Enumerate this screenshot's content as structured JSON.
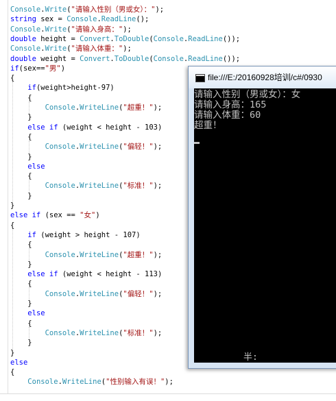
{
  "editor": {
    "lines": [
      [
        {
          "c": "t",
          "v": "Console"
        },
        {
          "c": "",
          "v": "."
        },
        {
          "c": "t",
          "v": "Write"
        },
        {
          "c": "",
          "v": "("
        },
        {
          "c": "s",
          "v": "\"请输入性别（男或女）：\""
        },
        {
          "c": "",
          "v": ");"
        }
      ],
      [
        {
          "c": "k",
          "v": "string"
        },
        {
          "c": "",
          "v": " sex = "
        },
        {
          "c": "t",
          "v": "Console"
        },
        {
          "c": "",
          "v": "."
        },
        {
          "c": "t",
          "v": "ReadLine"
        },
        {
          "c": "",
          "v": "();"
        }
      ],
      [
        {
          "c": "t",
          "v": "Console"
        },
        {
          "c": "",
          "v": "."
        },
        {
          "c": "t",
          "v": "Write"
        },
        {
          "c": "",
          "v": "("
        },
        {
          "c": "s",
          "v": "\"请输入身高：\""
        },
        {
          "c": "",
          "v": ");"
        }
      ],
      [
        {
          "c": "k",
          "v": "double"
        },
        {
          "c": "",
          "v": " height = "
        },
        {
          "c": "t",
          "v": "Convert"
        },
        {
          "c": "",
          "v": "."
        },
        {
          "c": "t",
          "v": "ToDouble"
        },
        {
          "c": "",
          "v": "("
        },
        {
          "c": "t",
          "v": "Console"
        },
        {
          "c": "",
          "v": "."
        },
        {
          "c": "t",
          "v": "ReadLine"
        },
        {
          "c": "",
          "v": "());"
        }
      ],
      [
        {
          "c": "t",
          "v": "Console"
        },
        {
          "c": "",
          "v": "."
        },
        {
          "c": "t",
          "v": "Write"
        },
        {
          "c": "",
          "v": "("
        },
        {
          "c": "s",
          "v": "\"请输入体重：\""
        },
        {
          "c": "",
          "v": ");"
        }
      ],
      [
        {
          "c": "k",
          "v": "double"
        },
        {
          "c": "",
          "v": " weight = "
        },
        {
          "c": "t",
          "v": "Convert"
        },
        {
          "c": "",
          "v": "."
        },
        {
          "c": "t",
          "v": "ToDouble"
        },
        {
          "c": "",
          "v": "("
        },
        {
          "c": "t",
          "v": "Console"
        },
        {
          "c": "",
          "v": "."
        },
        {
          "c": "t",
          "v": "ReadLine"
        },
        {
          "c": "",
          "v": "());"
        }
      ],
      [
        {
          "c": "k",
          "v": "if"
        },
        {
          "c": "",
          "v": "(sex=="
        },
        {
          "c": "s",
          "v": "\"男\""
        },
        {
          "c": "",
          "v": ")"
        }
      ],
      [
        {
          "c": "",
          "v": "{"
        }
      ],
      [
        {
          "c": "",
          "v": "    "
        },
        {
          "c": "k",
          "v": "if"
        },
        {
          "c": "",
          "v": "(weight>height-97)"
        }
      ],
      [
        {
          "c": "",
          "v": "    {"
        }
      ],
      [
        {
          "c": "",
          "v": "        "
        },
        {
          "c": "t",
          "v": "Console"
        },
        {
          "c": "",
          "v": "."
        },
        {
          "c": "t",
          "v": "WriteLine"
        },
        {
          "c": "",
          "v": "("
        },
        {
          "c": "s",
          "v": "\"超重！\""
        },
        {
          "c": "",
          "v": ");"
        }
      ],
      [
        {
          "c": "",
          "v": "    }"
        }
      ],
      [
        {
          "c": "",
          "v": "    "
        },
        {
          "c": "k",
          "v": "else if"
        },
        {
          "c": "",
          "v": " (weight < height - 103)"
        }
      ],
      [
        {
          "c": "",
          "v": "    {"
        }
      ],
      [
        {
          "c": "",
          "v": "        "
        },
        {
          "c": "t",
          "v": "Console"
        },
        {
          "c": "",
          "v": "."
        },
        {
          "c": "t",
          "v": "WriteLine"
        },
        {
          "c": "",
          "v": "("
        },
        {
          "c": "s",
          "v": "\"偏轻！\""
        },
        {
          "c": "",
          "v": ");"
        }
      ],
      [
        {
          "c": "",
          "v": "    }"
        }
      ],
      [
        {
          "c": "",
          "v": "    "
        },
        {
          "c": "k",
          "v": "else"
        }
      ],
      [
        {
          "c": "",
          "v": "    {"
        }
      ],
      [
        {
          "c": "",
          "v": "        "
        },
        {
          "c": "t",
          "v": "Console"
        },
        {
          "c": "",
          "v": "."
        },
        {
          "c": "t",
          "v": "WriteLine"
        },
        {
          "c": "",
          "v": "("
        },
        {
          "c": "s",
          "v": "\"标准！\""
        },
        {
          "c": "",
          "v": ");"
        }
      ],
      [
        {
          "c": "",
          "v": "    }"
        }
      ],
      [
        {
          "c": "",
          "v": "}"
        }
      ],
      [
        {
          "c": "k",
          "v": "else if"
        },
        {
          "c": "",
          "v": " (sex == "
        },
        {
          "c": "s",
          "v": "\"女\""
        },
        {
          "c": "",
          "v": ")"
        }
      ],
      [
        {
          "c": "",
          "v": "{"
        }
      ],
      [
        {
          "c": "",
          "v": "    "
        },
        {
          "c": "k",
          "v": "if"
        },
        {
          "c": "",
          "v": " (weight > height - 107)"
        }
      ],
      [
        {
          "c": "",
          "v": "    {"
        }
      ],
      [
        {
          "c": "",
          "v": "        "
        },
        {
          "c": "t",
          "v": "Console"
        },
        {
          "c": "",
          "v": "."
        },
        {
          "c": "t",
          "v": "WriteLine"
        },
        {
          "c": "",
          "v": "("
        },
        {
          "c": "s",
          "v": "\"超重！\""
        },
        {
          "c": "",
          "v": ");"
        }
      ],
      [
        {
          "c": "",
          "v": "    }"
        }
      ],
      [
        {
          "c": "",
          "v": "    "
        },
        {
          "c": "k",
          "v": "else if"
        },
        {
          "c": "",
          "v": " (weight < height - 113)"
        }
      ],
      [
        {
          "c": "",
          "v": "    {"
        }
      ],
      [
        {
          "c": "",
          "v": "        "
        },
        {
          "c": "t",
          "v": "Console"
        },
        {
          "c": "",
          "v": "."
        },
        {
          "c": "t",
          "v": "WriteLine"
        },
        {
          "c": "",
          "v": "("
        },
        {
          "c": "s",
          "v": "\"偏轻！\""
        },
        {
          "c": "",
          "v": ");"
        }
      ],
      [
        {
          "c": "",
          "v": "    }"
        }
      ],
      [
        {
          "c": "",
          "v": "    "
        },
        {
          "c": "k",
          "v": "else"
        }
      ],
      [
        {
          "c": "",
          "v": "    {"
        }
      ],
      [
        {
          "c": "",
          "v": "        "
        },
        {
          "c": "t",
          "v": "Console"
        },
        {
          "c": "",
          "v": "."
        },
        {
          "c": "t",
          "v": "WriteLine"
        },
        {
          "c": "",
          "v": "("
        },
        {
          "c": "s",
          "v": "\"标准！\""
        },
        {
          "c": "",
          "v": ");"
        }
      ],
      [
        {
          "c": "",
          "v": "    }"
        }
      ],
      [
        {
          "c": "",
          "v": "}"
        }
      ],
      [
        {
          "c": "k",
          "v": "else"
        }
      ],
      [
        {
          "c": "",
          "v": "{"
        }
      ],
      [
        {
          "c": "",
          "v": "    "
        },
        {
          "c": "t",
          "v": "Console"
        },
        {
          "c": "",
          "v": "."
        },
        {
          "c": "t",
          "v": "WriteLine"
        },
        {
          "c": "",
          "v": "("
        },
        {
          "c": "s",
          "v": "\"性别输入有误！\""
        },
        {
          "c": "",
          "v": ");"
        }
      ]
    ],
    "colors": {
      "keyword": "#0000ff",
      "type": "#2b91af",
      "string": "#a31515",
      "text": "#000000"
    }
  },
  "console": {
    "title": "file:///E:/20160928培训/c#/0930",
    "output_lines": [
      "请输入性别（男或女）：女",
      "请输入身高：165",
      "请输入体重：60",
      "超重！"
    ],
    "ime_indicator": "半:",
    "colors": {
      "background": "#000000",
      "text": "#c0c0c0"
    },
    "icon": "console-window-icon"
  }
}
